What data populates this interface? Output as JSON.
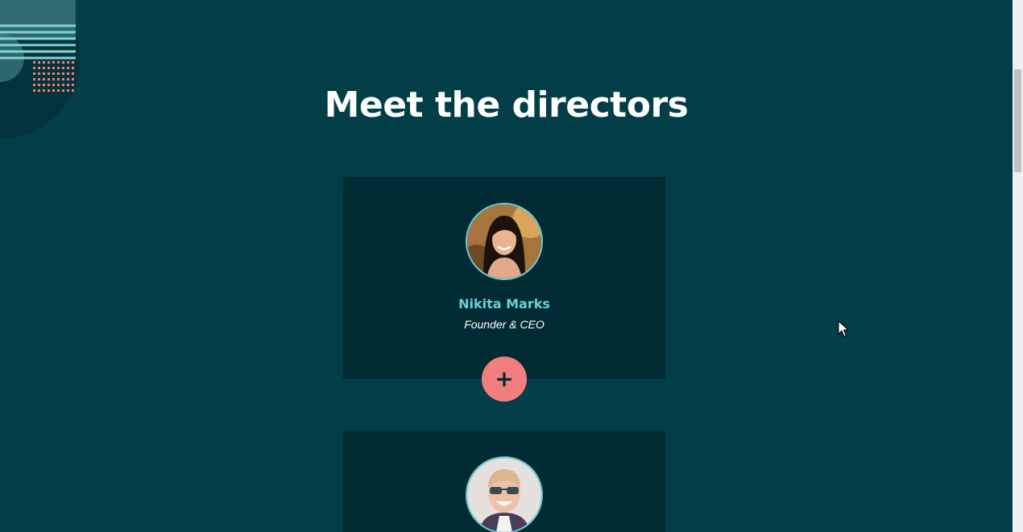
{
  "section": {
    "title": "Meet the directors"
  },
  "directors": [
    {
      "name": "Nikita Marks",
      "role": "Founder & CEO",
      "avatar_icon": "woman-portrait-photo"
    },
    {
      "avatar_icon": "man-sunglasses-portrait-photo"
    }
  ],
  "expand_button": {
    "label": "+",
    "color": "#f27d7d"
  },
  "colors": {
    "background": "#023e48",
    "card": "#012b32",
    "accent_teal": "#6ecdd3",
    "accent_coral": "#f27d7d"
  }
}
